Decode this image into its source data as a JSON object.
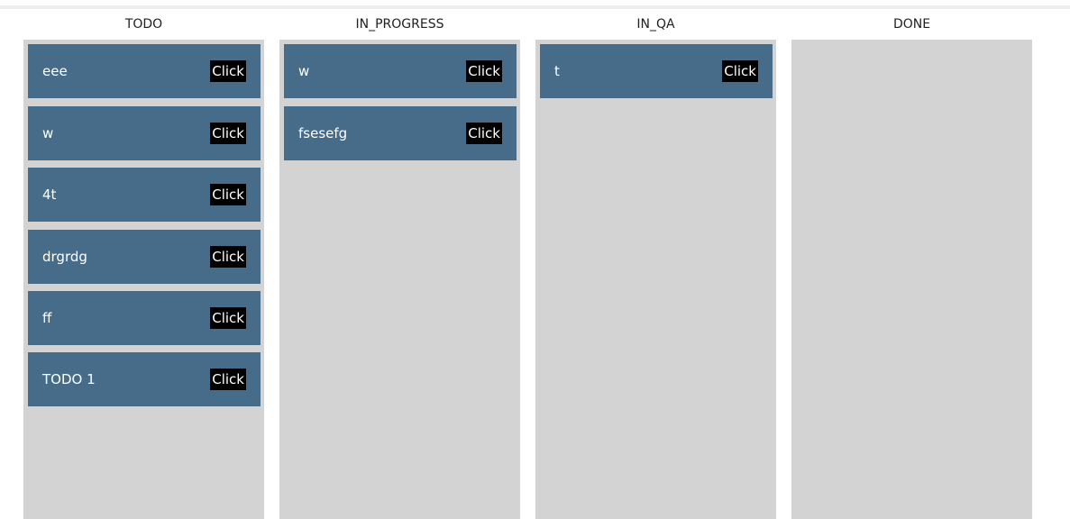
{
  "colors": {
    "column_bg": "#d3d3d3",
    "card_bg": "#466c89",
    "card_text": "#ffffff",
    "button_bg": "#000000"
  },
  "columns": [
    {
      "title": "TODO",
      "cards": [
        {
          "title": "eee",
          "button": "Click"
        },
        {
          "title": "w",
          "button": "Click"
        },
        {
          "title": "4t",
          "button": "Click"
        },
        {
          "title": "drgrdg",
          "button": "Click"
        },
        {
          "title": "ff",
          "button": "Click"
        },
        {
          "title": "TODO 1",
          "button": "Click"
        }
      ]
    },
    {
      "title": "IN_PROGRESS",
      "cards": [
        {
          "title": "w",
          "button": "Click"
        },
        {
          "title": "fsesefg",
          "button": "Click"
        }
      ]
    },
    {
      "title": "IN_QA",
      "cards": [
        {
          "title": "t",
          "button": "Click"
        }
      ]
    },
    {
      "title": "DONE",
      "cards": []
    }
  ]
}
